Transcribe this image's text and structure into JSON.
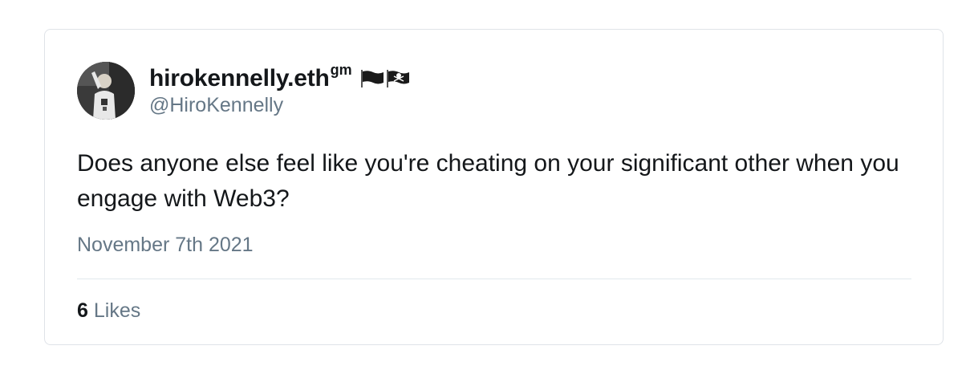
{
  "tweet": {
    "display_name": "hirokennelly.eth",
    "display_name_suffix": "gm",
    "handle": "@HiroKennelly",
    "text": "Does anyone else feel like you're cheating on your significant other when you engage with Web3?",
    "date": "November 7th 2021",
    "likes_count": "6",
    "likes_label": "Likes"
  },
  "icons": {
    "avatar": "profile-photo",
    "flag1": "black-flag-icon",
    "flag2": "pirate-flag-icon"
  },
  "colors": {
    "text_primary": "#14171a",
    "text_secondary": "#657786",
    "border": "#dfe3e8",
    "divider": "#e1e8ed"
  }
}
